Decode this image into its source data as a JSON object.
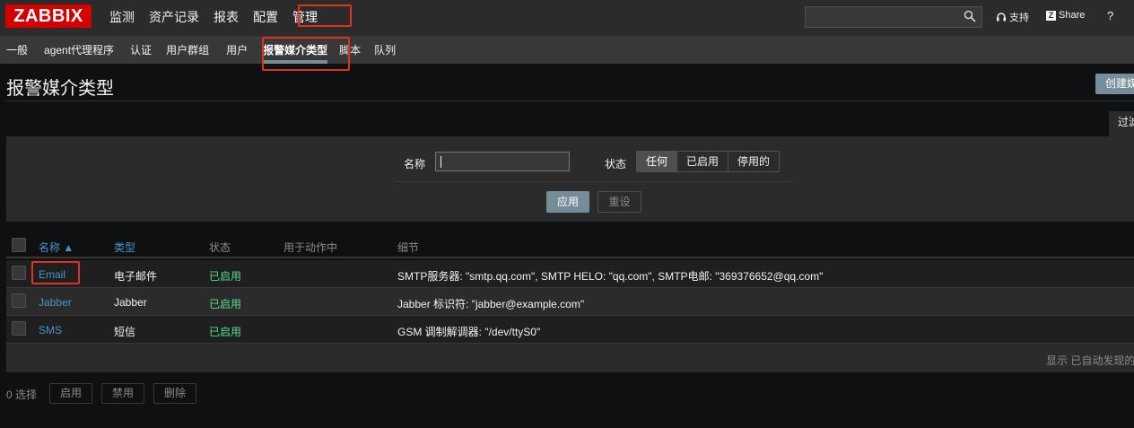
{
  "logo": "ZABBIX",
  "topnav": [
    "监测",
    "资产记录",
    "报表",
    "配置",
    "管理"
  ],
  "topnav_active": "管理",
  "search": {
    "value": ""
  },
  "support_label": "支持",
  "share_label": "Share",
  "help_label": "?",
  "subnav": [
    "一般",
    "agent代理程序",
    "认证",
    "用户群组",
    "用户",
    "报警媒介类型",
    "脚本",
    "队列"
  ],
  "subnav_selected": "报警媒介类型",
  "page_title": "报警媒介类型",
  "create_button": "创建媒",
  "filter_tab": "过滤",
  "filter": {
    "name_label": "名称",
    "name_value": "",
    "status_label": "状态",
    "status_options": [
      "任何",
      "已启用",
      "停用的"
    ],
    "status_selected": "任何",
    "apply_label": "应用",
    "reset_label": "重设"
  },
  "table": {
    "headers": {
      "name": "名称 ▲",
      "type": "类型",
      "status": "状态",
      "used_in": "用于动作中",
      "details": "细节"
    },
    "rows": [
      {
        "name": "Email",
        "type": "电子邮件",
        "status": "已启用",
        "used_in": "",
        "details": "SMTP服务器: \"smtp.qq.com\", SMTP HELO: \"qq.com\", SMTP电邮: \"369376652@qq.com\""
      },
      {
        "name": "Jabber",
        "type": "Jabber",
        "status": "已启用",
        "used_in": "",
        "details": "Jabber 标识符: \"jabber@example.com\""
      },
      {
        "name": "SMS",
        "type": "短信",
        "status": "已启用",
        "used_in": "",
        "details": "GSM 调制解调器: \"/dev/ttyS0\""
      }
    ],
    "footer": "显示 已自动发现的"
  },
  "bottom": {
    "selected": "0 选择",
    "enable": "启用",
    "disable": "禁用",
    "delete": "删除"
  },
  "colors": {
    "brand": "#d40000",
    "link": "#4796c4",
    "enabled": "#59db8f",
    "highlight": "#e0301e",
    "button": "#768d99"
  }
}
